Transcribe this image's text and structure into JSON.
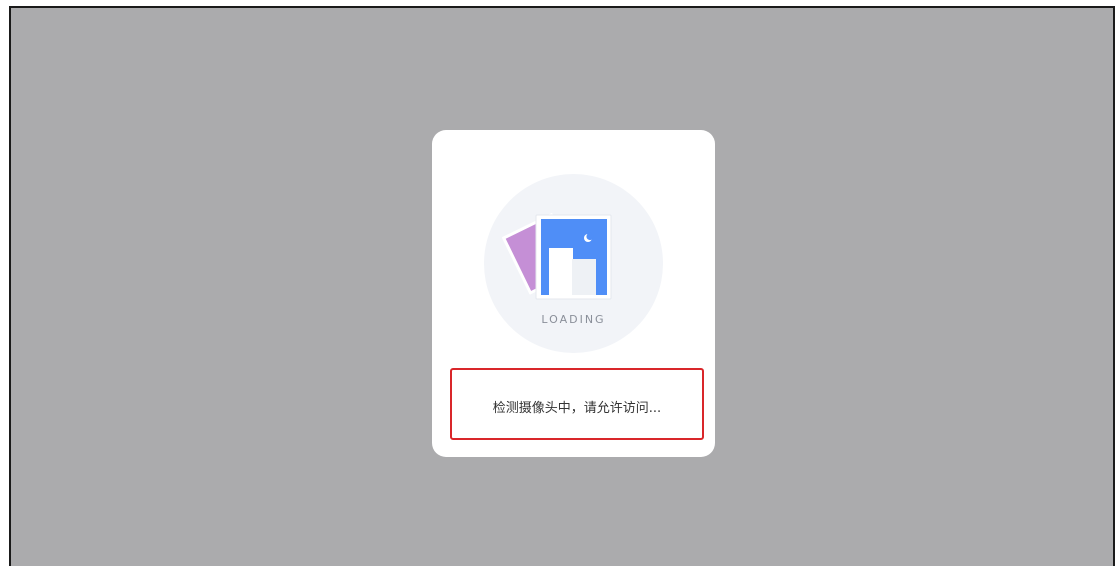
{
  "loading_label": "LOADING",
  "status_message": "检测摄像头中，请允许访问...",
  "colors": {
    "overlay": "#ababad",
    "card": "#ffffff",
    "circle": "#f2f4f8",
    "photo_back": "#c58fd6",
    "photo_front": "#4f8ef7",
    "highlight_border": "#d9262a"
  },
  "icons": {
    "illustration": "photo-stack-loading-icon",
    "moon": "moon-icon"
  }
}
